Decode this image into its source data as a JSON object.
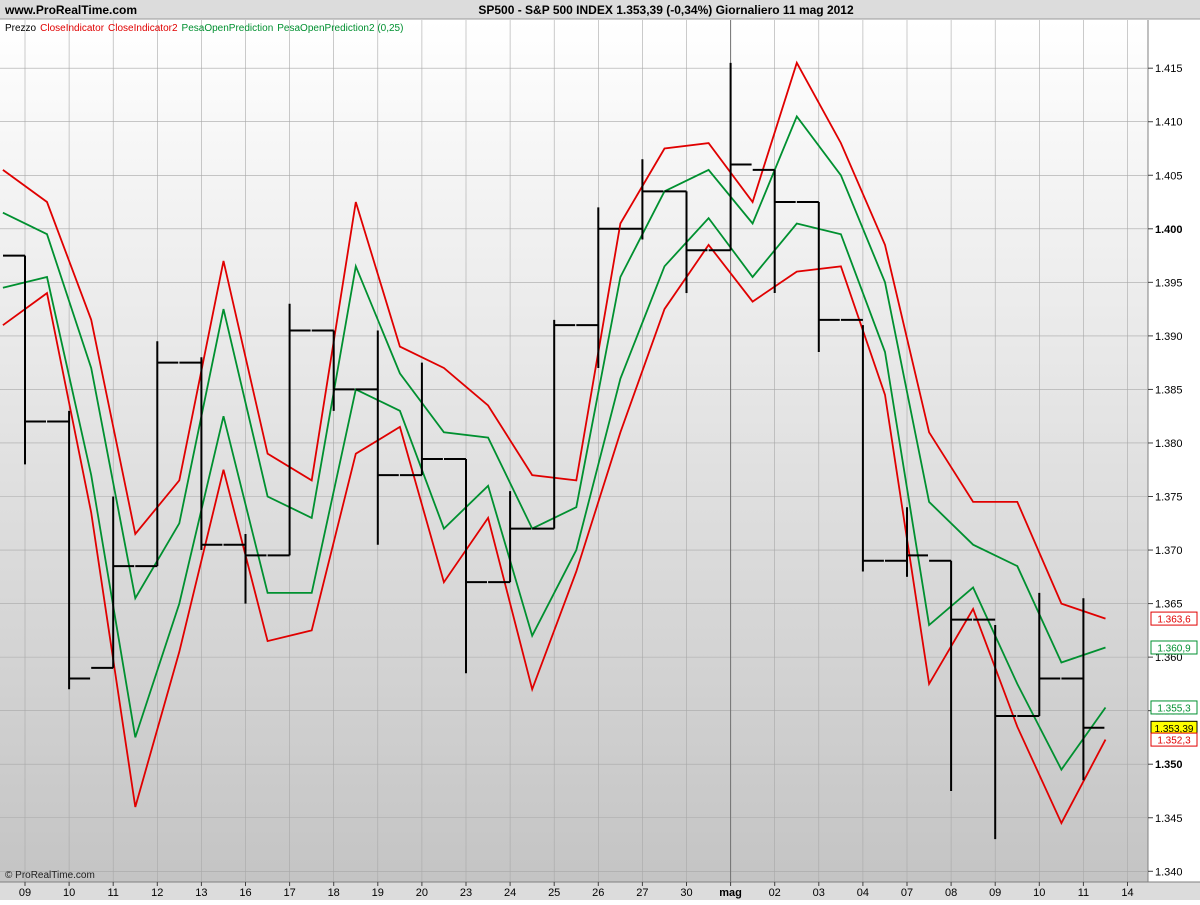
{
  "header": {
    "site": "www.ProRealTime.com",
    "title": "SP500 - S&P 500 INDEX    1.353,39 (-0,34%)    Giornaliero  11 mag 2012"
  },
  "legend": {
    "prefix": "Prezzo",
    "entries": [
      {
        "text": "CloseIndicator",
        "color": "#e00000"
      },
      {
        "text": "CloseIndicator2",
        "color": "#e00000"
      },
      {
        "text": "PesaOpenPrediction",
        "color": "#009030"
      },
      {
        "text": "PesaOpenPrediction2 (0,25)",
        "color": "#009030"
      }
    ]
  },
  "copyright": "© ProRealTime.com",
  "colors": {
    "price": "#000000",
    "red": "#e00000",
    "green": "#009030",
    "header_bg": "#dcdcdc",
    "plot_top": "#ffffff",
    "plot_bottom": "#c8c8c8",
    "grid": "#a8a8a8",
    "highlight": "#ffff00"
  },
  "chart_data": {
    "type": "line",
    "ylim": [
      1.339,
      1.4195
    ],
    "y_ticks": [
      {
        "value": 1.34,
        "label": "1.340",
        "bold": false
      },
      {
        "value": 1.345,
        "label": "1.345",
        "bold": false
      },
      {
        "value": 1.35,
        "label": "1.350",
        "bold": true
      },
      {
        "value": 1.355,
        "label": "1.355",
        "bold": false
      },
      {
        "value": 1.36,
        "label": "1.360",
        "bold": false
      },
      {
        "value": 1.365,
        "label": "1.365",
        "bold": false
      },
      {
        "value": 1.37,
        "label": "1.370",
        "bold": false
      },
      {
        "value": 1.375,
        "label": "1.375",
        "bold": false
      },
      {
        "value": 1.38,
        "label": "1.380",
        "bold": false
      },
      {
        "value": 1.385,
        "label": "1.385",
        "bold": false
      },
      {
        "value": 1.39,
        "label": "1.390",
        "bold": false
      },
      {
        "value": 1.395,
        "label": "1.395",
        "bold": false
      },
      {
        "value": 1.4,
        "label": "1.400",
        "bold": true
      },
      {
        "value": 1.405,
        "label": "1.405",
        "bold": false
      },
      {
        "value": 1.41,
        "label": "1.410",
        "bold": false
      },
      {
        "value": 1.415,
        "label": "1.415",
        "bold": false
      }
    ],
    "x_labels": [
      "09",
      "10",
      "11",
      "12",
      "13",
      "16",
      "17",
      "18",
      "19",
      "20",
      "23",
      "24",
      "25",
      "26",
      "27",
      "30",
      "mag",
      "02",
      "03",
      "04",
      "07",
      "08",
      "09",
      "10",
      "11",
      "14"
    ],
    "month_separator_label": "mag",
    "price_bars": [
      {
        "date": "09",
        "open": 1.3975,
        "high": 1.3975,
        "low": 1.378,
        "close": 1.382
      },
      {
        "date": "10",
        "open": 1.382,
        "high": 1.383,
        "low": 1.357,
        "close": 1.358
      },
      {
        "date": "11",
        "open": 1.359,
        "high": 1.375,
        "low": 1.359,
        "close": 1.3685
      },
      {
        "date": "12",
        "open": 1.3685,
        "high": 1.3895,
        "low": 1.3685,
        "close": 1.3875
      },
      {
        "date": "13",
        "open": 1.3875,
        "high": 1.388,
        "low": 1.37,
        "close": 1.3705
      },
      {
        "date": "16",
        "open": 1.3705,
        "high": 1.3715,
        "low": 1.365,
        "close": 1.3695
      },
      {
        "date": "17",
        "open": 1.3695,
        "high": 1.393,
        "low": 1.3695,
        "close": 1.3905
      },
      {
        "date": "18",
        "open": 1.3905,
        "high": 1.3905,
        "low": 1.383,
        "close": 1.385
      },
      {
        "date": "19",
        "open": 1.385,
        "high": 1.3905,
        "low": 1.3705,
        "close": 1.377
      },
      {
        "date": "20",
        "open": 1.377,
        "high": 1.3875,
        "low": 1.377,
        "close": 1.3785
      },
      {
        "date": "23",
        "open": 1.3785,
        "high": 1.3785,
        "low": 1.3585,
        "close": 1.367
      },
      {
        "date": "24",
        "open": 1.367,
        "high": 1.3755,
        "low": 1.367,
        "close": 1.372
      },
      {
        "date": "25",
        "open": 1.372,
        "high": 1.3915,
        "low": 1.372,
        "close": 1.391
      },
      {
        "date": "26",
        "open": 1.391,
        "high": 1.402,
        "low": 1.387,
        "close": 1.4
      },
      {
        "date": "27",
        "open": 1.4,
        "high": 1.4065,
        "low": 1.399,
        "close": 1.4035
      },
      {
        "date": "30",
        "open": 1.4035,
        "high": 1.4035,
        "low": 1.394,
        "close": 1.398
      },
      {
        "date": "mag",
        "open": 1.398,
        "high": 1.4155,
        "low": 1.398,
        "close": 1.406
      },
      {
        "date": "02",
        "open": 1.4055,
        "high": 1.4055,
        "low": 1.394,
        "close": 1.4025
      },
      {
        "date": "03",
        "open": 1.4025,
        "high": 1.4025,
        "low": 1.3885,
        "close": 1.3915
      },
      {
        "date": "04",
        "open": 1.3915,
        "high": 1.391,
        "low": 1.368,
        "close": 1.369
      },
      {
        "date": "07",
        "open": 1.369,
        "high": 1.374,
        "low": 1.3675,
        "close": 1.3695
      },
      {
        "date": "08",
        "open": 1.369,
        "high": 1.369,
        "low": 1.3475,
        "close": 1.3635
      },
      {
        "date": "09",
        "open": 1.3635,
        "high": 1.363,
        "low": 1.343,
        "close": 1.3545
      },
      {
        "date": "10",
        "open": 1.3545,
        "high": 1.366,
        "low": 1.3545,
        "close": 1.358
      },
      {
        "date": "11",
        "open": 1.358,
        "high": 1.3655,
        "low": 1.3485,
        "close": 1.3534
      }
    ],
    "series": [
      {
        "name": "CloseIndicator",
        "color": "#e00000",
        "start_index": -0.5,
        "values": [
          1.4055,
          1.4025,
          1.3915,
          1.3715,
          1.3765,
          1.397,
          1.379,
          1.3765,
          1.4025,
          1.389,
          1.387,
          1.3835,
          1.377,
          1.3765,
          1.4005,
          1.4075,
          1.408,
          1.4025,
          1.4155,
          1.408,
          1.3985,
          1.381,
          1.3745,
          1.3745,
          1.365,
          1.3636
        ]
      },
      {
        "name": "CloseIndicator2",
        "color": "#e00000",
        "start_index": -0.5,
        "values": [
          1.391,
          1.394,
          1.3735,
          1.346,
          1.3605,
          1.3775,
          1.3615,
          1.3625,
          1.379,
          1.3815,
          1.367,
          1.373,
          1.357,
          1.368,
          1.381,
          1.3925,
          1.3985,
          1.3932,
          1.396,
          1.3965,
          1.3845,
          1.3575,
          1.3645,
          1.3535,
          1.3445,
          1.3523
        ]
      },
      {
        "name": "PesaOpenPrediction",
        "color": "#009030",
        "start_index": -0.5,
        "values": [
          1.4015,
          1.3995,
          1.387,
          1.3655,
          1.3725,
          1.3925,
          1.375,
          1.373,
          1.3965,
          1.3865,
          1.381,
          1.3805,
          1.372,
          1.374,
          1.3955,
          1.4035,
          1.4055,
          1.4005,
          1.4105,
          1.405,
          1.395,
          1.3745,
          1.3705,
          1.3685,
          1.3595,
          1.3609
        ]
      },
      {
        "name": "PesaOpenPrediction2 (0,25)",
        "color": "#009030",
        "start_index": -0.5,
        "values": [
          1.3945,
          1.3955,
          1.377,
          1.3525,
          1.365,
          1.3825,
          1.366,
          1.366,
          1.385,
          1.383,
          1.372,
          1.376,
          1.362,
          1.37,
          1.386,
          1.3965,
          1.401,
          1.3955,
          1.4005,
          1.3995,
          1.3885,
          1.363,
          1.3665,
          1.3575,
          1.3495,
          1.3553
        ]
      }
    ],
    "value_labels": [
      {
        "text": "1.363,6",
        "value": 1.3636,
        "color": "#e00000",
        "highlight": false
      },
      {
        "text": "1.360,9",
        "value": 1.3609,
        "color": "#009030",
        "highlight": false
      },
      {
        "text": "1.355,3",
        "value": 1.3553,
        "color": "#009030",
        "highlight": false
      },
      {
        "text": "1.353,39",
        "value": 1.3534,
        "color": "#000000",
        "highlight": true
      },
      {
        "text": "1.352,3",
        "value": 1.3523,
        "color": "#e00000",
        "highlight": false
      }
    ]
  }
}
